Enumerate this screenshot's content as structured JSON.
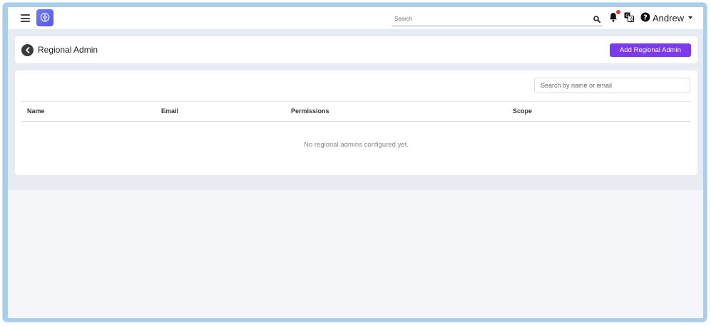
{
  "topbar": {
    "search_placeholder": "Search",
    "user_name": "Andrew",
    "icons": {
      "menu": "menu-icon",
      "logo": "brain-logo-icon",
      "search": "search-icon",
      "notifications": "bell-icon",
      "language": "translate-icon",
      "help": "help-icon"
    },
    "has_notification": true
  },
  "page": {
    "title": "Regional Admin",
    "add_button_label": "Add Regional Admin"
  },
  "table": {
    "search_placeholder": "Search by name or email",
    "columns": [
      "Name",
      "Email",
      "Permissions",
      "Scope"
    ],
    "rows": [],
    "empty_message": "No regional admins configured yet."
  },
  "colors": {
    "accent": "#7c3aed",
    "logo": "#5a56e8",
    "notification_dot": "#e53935"
  }
}
